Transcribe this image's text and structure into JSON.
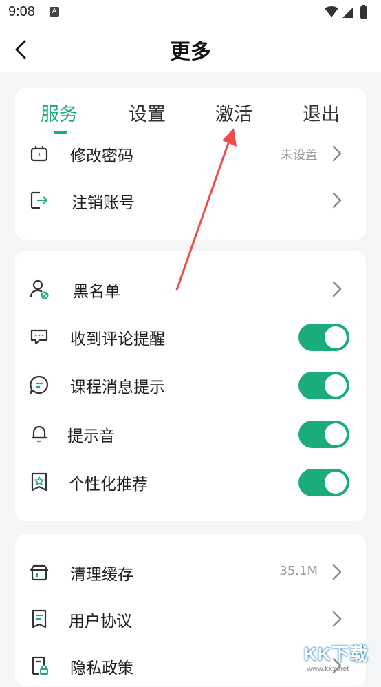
{
  "status_bar": {
    "time": "9:08",
    "notification_badge": "A"
  },
  "header": {
    "title": "更多"
  },
  "tabs": [
    {
      "label": "服务",
      "active": true
    },
    {
      "label": "设置",
      "active": false
    },
    {
      "label": "激活",
      "active": false
    },
    {
      "label": "退出",
      "active": false
    }
  ],
  "account_rows": [
    {
      "label": "修改密码",
      "value": "未设置",
      "icon": "phone-lock-icon"
    },
    {
      "label": "注销账号",
      "value": "",
      "icon": "logout-icon"
    }
  ],
  "notify_rows": [
    {
      "label": "黑名单",
      "icon": "user-block-icon",
      "type": "link"
    },
    {
      "label": "收到评论提醒",
      "icon": "comment-icon",
      "type": "toggle",
      "on": true
    },
    {
      "label": "课程消息提示",
      "icon": "message-icon",
      "type": "toggle",
      "on": true
    },
    {
      "label": "提示音",
      "icon": "bell-icon",
      "type": "toggle",
      "on": true
    },
    {
      "label": "个性化推荐",
      "icon": "star-bookmark-icon",
      "type": "toggle",
      "on": true
    }
  ],
  "misc_rows": [
    {
      "label": "清理缓存",
      "value": "35.1M",
      "icon": "broom-icon"
    },
    {
      "label": "用户协议",
      "value": "",
      "icon": "document-icon"
    },
    {
      "label": "隐私政策",
      "value": "",
      "icon": "privacy-icon"
    }
  ],
  "watermark": {
    "text": "KK下载",
    "sub": "www.kkx.net"
  },
  "colors": {
    "accent": "#1aad7b",
    "arrow": "#f04a4a"
  }
}
